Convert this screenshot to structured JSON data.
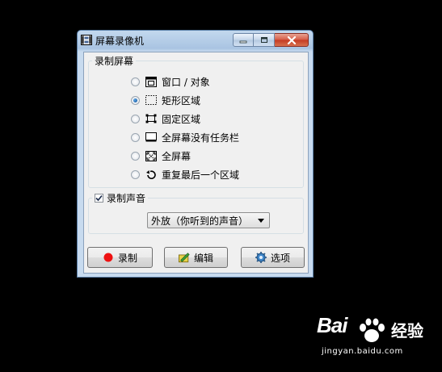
{
  "window": {
    "title": "屏幕录像机"
  },
  "capture_group": {
    "legend": "录制屏幕",
    "options": [
      {
        "label": "窗口 / 对象",
        "icon": "window-icon",
        "checked": false
      },
      {
        "label": "矩形区域",
        "icon": "rect-region-icon",
        "checked": true
      },
      {
        "label": "固定区域",
        "icon": "fixed-region-icon",
        "checked": false
      },
      {
        "label": "全屏幕没有任务栏",
        "icon": "fullscreen-no-taskbar-icon",
        "checked": false
      },
      {
        "label": "全屏幕",
        "icon": "fullscreen-icon",
        "checked": false
      },
      {
        "label": "重复最后一个区域",
        "icon": "repeat-region-icon",
        "checked": false
      }
    ]
  },
  "audio_group": {
    "legend": "录制声音",
    "checked": true,
    "selected": "外放（你听到的声音）"
  },
  "buttons": {
    "record": "录制",
    "edit": "编辑",
    "options": "选项"
  },
  "watermark": {
    "brand_a": "Bai",
    "brand_b": "经验",
    "url": "jingyan.baidu.com"
  },
  "colors": {
    "record_dot": "#ee1111",
    "radio_selected": "#0c4d96"
  }
}
